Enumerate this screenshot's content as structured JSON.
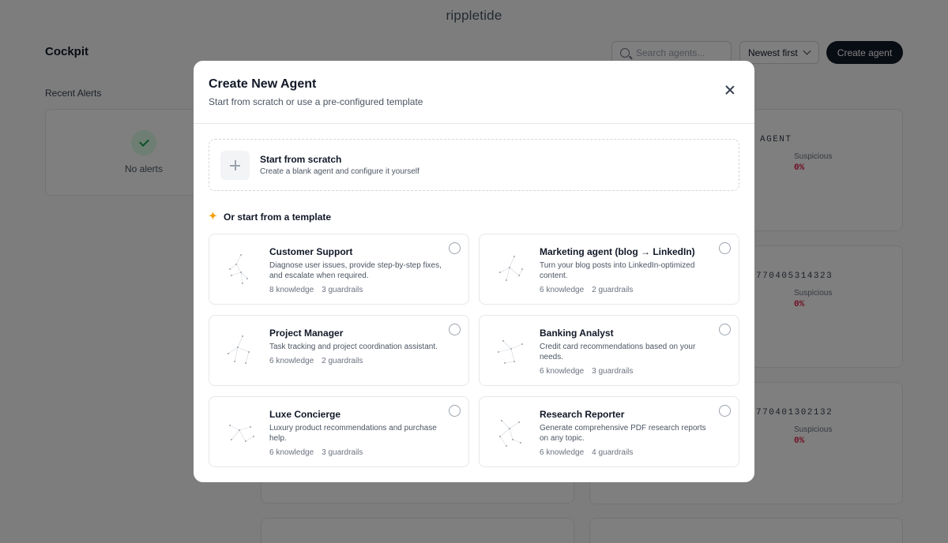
{
  "brand": "rippletide",
  "page": {
    "title": "Cockpit",
    "search_placeholder": "Search agents...",
    "sort_label": "Newest first",
    "create_label": "Create agent",
    "alerts_heading": "Recent Alerts",
    "no_alerts": "No alerts"
  },
  "agent_cards": [
    {
      "id_text": "AGENT",
      "suspicious_label": "Suspicious",
      "suspicious_value": "0%"
    },
    {
      "id_text": "770405314323",
      "suspicious_label": "Suspicious",
      "suspicious_value": "0%"
    },
    {
      "id_text": "770401302132",
      "suspicious_label": "Suspicious",
      "suspicious_value": "0%"
    }
  ],
  "modal": {
    "title": "Create New Agent",
    "subtitle": "Start from scratch or use a pre-configured template",
    "scratch_title": "Start from scratch",
    "scratch_desc": "Create a blank agent and configure it yourself",
    "templates_heading": "Or start from a template",
    "templates": [
      {
        "name": "Customer Support",
        "desc": "Diagnose user issues, provide step-by-step fixes, and escalate when required.",
        "knowledge": "8 knowledge",
        "guardrails": "3 guardrails"
      },
      {
        "name": "Marketing agent (blog → LinkedIn)",
        "desc": "Turn your blog posts into LinkedIn-optimized content.",
        "knowledge": "6 knowledge",
        "guardrails": "2 guardrails"
      },
      {
        "name": "Project Manager",
        "desc": "Task tracking and project coordination assistant.",
        "knowledge": "6 knowledge",
        "guardrails": "2 guardrails"
      },
      {
        "name": "Banking Analyst",
        "desc": "Credit card recommendations based on your needs.",
        "knowledge": "6 knowledge",
        "guardrails": "3 guardrails"
      },
      {
        "name": "Luxe Concierge",
        "desc": "Luxury product recommendations and purchase help.",
        "knowledge": "6 knowledge",
        "guardrails": "3 guardrails"
      },
      {
        "name": "Research Reporter",
        "desc": "Generate comprehensive PDF research reports on any topic.",
        "knowledge": "6 knowledge",
        "guardrails": "4 guardrails"
      }
    ]
  },
  "colors": {
    "primary": "#111827",
    "suspicious": "#e11d48",
    "success": "#16a34a",
    "sparkle": "#f59e0b"
  }
}
